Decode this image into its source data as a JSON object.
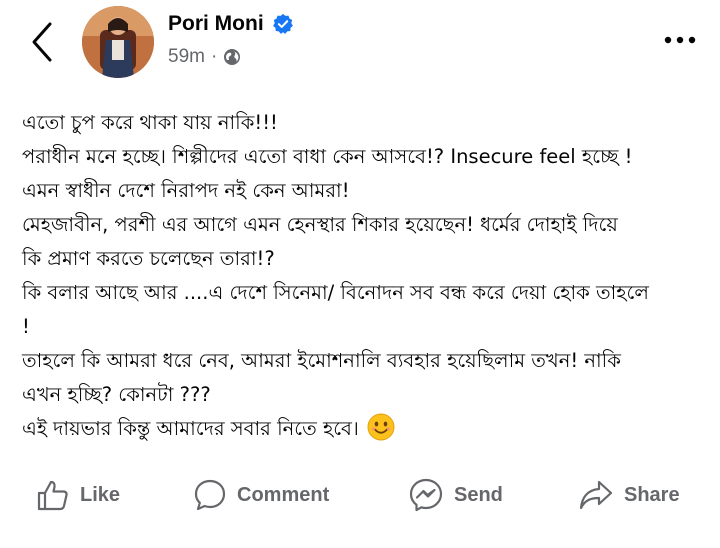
{
  "post": {
    "author": "Pori Moni",
    "time": "59m",
    "dot": "·",
    "privacy_icon": "globe-icon",
    "verified_color": "#1877f2",
    "lines": [
      "এতো চুপ করে থাকা যায় নাকি!!!",
      "পরাধীন মনে হচ্ছে। শিল্পীদের এতো বাধা কেন আসবে!? Insecure feel হচ্ছে !",
      "এমন স্বাধীন দেশে নিরাপদ নই কেন আমরা!",
      "মেহজাবীন, পরশী এর আগে এমন হেনস্থার শিকার হয়েছেন! ধর্মের দোহাই দিয়ে",
      "কি প্রমাণ করতে চলেছেন তারা!?",
      "কি বলার আছে আর ....এ দেশে সিনেমা/ বিনোদন সব বন্ধ করে দেয়া হোক তাহলে",
      "!",
      "তাহলে কি আমরা ধরে নেব, আমরা ইমোশনালি ব্যবহার হয়েছিলাম তখন! নাকি",
      "এখন হচ্ছি? কোনটা ???",
      "এই দায়ভার কিন্তু আমাদের সবার নিতে হবে।"
    ],
    "emoji": "smiling-face-emoji"
  },
  "actions": {
    "like": "Like",
    "comment": "Comment",
    "send": "Send",
    "share": "Share"
  },
  "colors": {
    "text": "#050505",
    "secondary": "#65676b"
  }
}
